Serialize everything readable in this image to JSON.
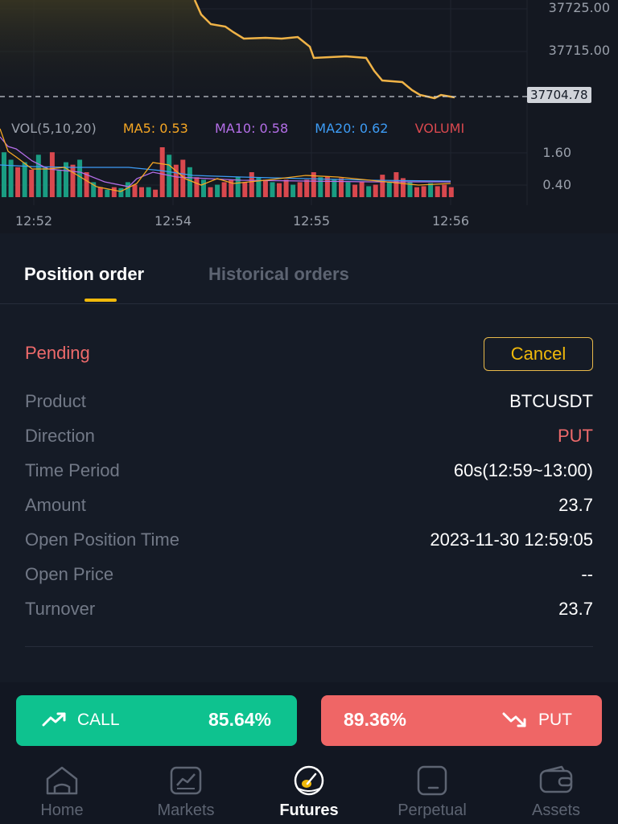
{
  "chart": {
    "price_levels": [
      "37725.00",
      "37715.00"
    ],
    "current_price": "37704.78",
    "volume_legend": {
      "vol": "VOL(5,10,20)",
      "ma5": "MA5: 0.53",
      "ma10": "MA10: 0.58",
      "ma20": "MA20: 0.62",
      "volume": "VOLUMI"
    },
    "volume_axis": [
      "1.60",
      "0.40"
    ],
    "time_labels": [
      "12:52",
      "12:54",
      "12:55",
      "12:56"
    ],
    "colors": {
      "price_line": "#f0b347",
      "ma5": "#f5a623",
      "ma10": "#b46ee8",
      "ma20": "#3d9cf5",
      "volume_up": "#1a9c82",
      "volume_down": "#d9484e"
    }
  },
  "tabs": [
    {
      "label": "Position order",
      "active": true
    },
    {
      "label": "Historical orders",
      "active": false
    }
  ],
  "order": {
    "status": "Pending",
    "cancel_label": "Cancel",
    "rows": [
      {
        "label": "Product",
        "value": "BTCUSDT"
      },
      {
        "label": "Direction",
        "value": "PUT"
      },
      {
        "label": "Time Period",
        "value": "60s(12:59~13:00)"
      },
      {
        "label": "Amount",
        "value": "23.7"
      },
      {
        "label": "Open Position Time",
        "value": "2023-11-30 12:59:05"
      },
      {
        "label": "Open Price",
        "value": "--"
      },
      {
        "label": "Turnover",
        "value": "23.7"
      }
    ]
  },
  "trade": {
    "call_label": "CALL",
    "call_pct": "85.64%",
    "put_label": "PUT",
    "put_pct": "89.36%",
    "call_color": "#0ec28f",
    "put_color": "#ef6666"
  },
  "nav": [
    {
      "label": "Home",
      "icon": "home-icon",
      "active": false
    },
    {
      "label": "Markets",
      "icon": "markets-icon",
      "active": false
    },
    {
      "label": "Futures",
      "icon": "futures-icon",
      "active": true
    },
    {
      "label": "Perpetual",
      "icon": "perpetual-icon",
      "active": false
    },
    {
      "label": "Assets",
      "icon": "wallet-icon",
      "active": false
    }
  ]
}
